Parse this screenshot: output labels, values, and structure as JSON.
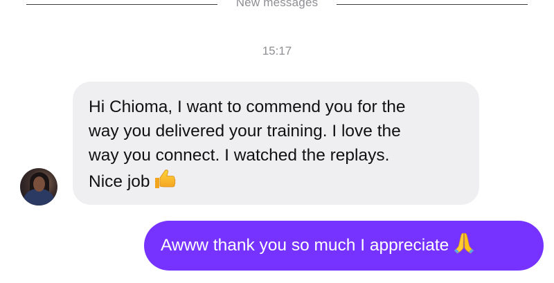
{
  "divider": {
    "label": "New messages"
  },
  "timestamp": "15:17",
  "messages": [
    {
      "direction": "incoming",
      "lines": [
        "Hi Chioma, I want to commend you for the",
        "way you delivered your training. I love the",
        "way you connect. I watched the replays.",
        "Nice job"
      ],
      "emoji": "thumbs-up-icon"
    },
    {
      "direction": "outgoing",
      "text": "Awww thank you so much I appreciate",
      "emoji": "folded-hands-icon"
    }
  ],
  "colors": {
    "incoming_bubble": "#efeff2",
    "outgoing_bubble": "#7633ff",
    "meta_text": "#8e8e93"
  }
}
